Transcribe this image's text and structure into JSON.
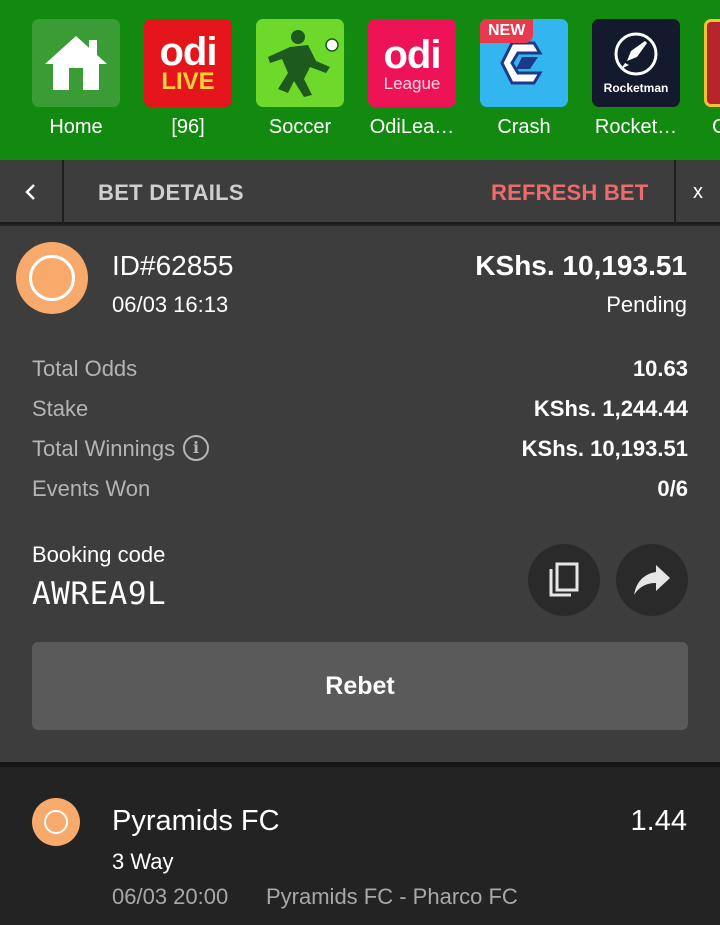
{
  "games_bar": {
    "items": [
      {
        "label": "Home",
        "icon": "home-icon"
      },
      {
        "label": "[96]",
        "tile_title": "odi",
        "tile_sub": "LIVE"
      },
      {
        "label": "Soccer",
        "icon": "soccer-player-icon"
      },
      {
        "label": "OdiLea…",
        "tile_title": "odi",
        "tile_sub": "League"
      },
      {
        "label": "Crash",
        "badge": "NEW",
        "icon": "crash-logo-icon"
      },
      {
        "label": "Rocket…",
        "tile_sub": "Rocketman",
        "icon": "rocket-icon"
      },
      {
        "label": "C"
      }
    ],
    "bg_color": "#128a0f"
  },
  "header": {
    "back_icon": "chevron-left-icon",
    "title": "BET DETAILS",
    "refresh_label": "REFRESH BET",
    "close_label": "x",
    "refresh_color": "#ef6a6a"
  },
  "bet": {
    "id": "ID#62855",
    "datetime": "06/03 16:13",
    "amount": "KShs. 10,193.51",
    "status": "Pending",
    "status_color": "#f7aa6c",
    "details": [
      {
        "label": "Total Odds",
        "value": "10.63"
      },
      {
        "label": "Stake",
        "value": "KShs. 1,244.44"
      },
      {
        "label": "Total Winnings",
        "value": "KShs. 10,193.51",
        "info_icon": "i"
      },
      {
        "label": "Events Won",
        "value": "0/6"
      }
    ],
    "booking_label": "Booking code",
    "booking_code": "AWREA9L",
    "copy_icon": "copy-icon",
    "share_icon": "share-icon",
    "rebet_label": "Rebet"
  },
  "event": {
    "team": "Pyramids FC",
    "odds": "1.44",
    "market": "3 Way",
    "kickoff": "06/03 20:00",
    "match": "Pyramids FC - Pharco FC"
  }
}
